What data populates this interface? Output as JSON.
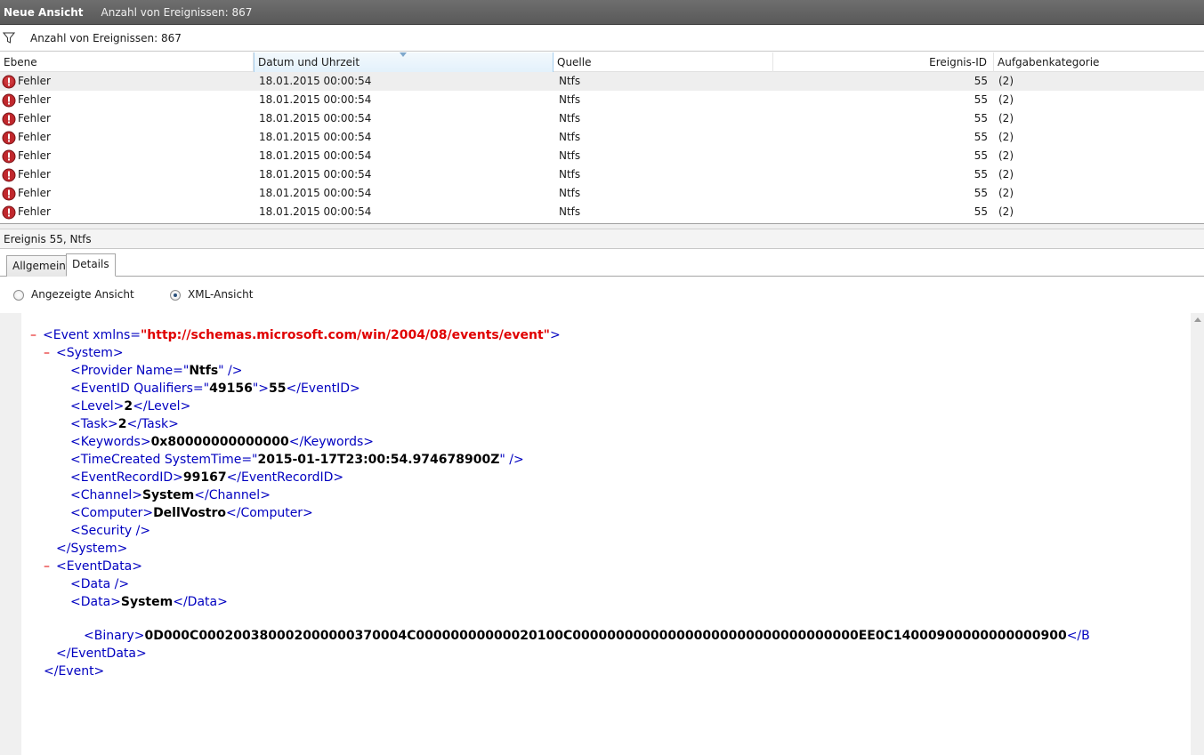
{
  "titlebar": {
    "title": "Neue Ansicht",
    "subtitle": "Anzahl von Ereignissen: 867"
  },
  "filterbar": {
    "text": "Anzahl von Ereignissen: 867",
    "icon": "funnel-icon"
  },
  "grid": {
    "columns": [
      "Ebene",
      "Datum und Uhrzeit",
      "Quelle",
      "Ereignis-ID",
      "Aufgabenkategorie"
    ],
    "sorted_column": "Datum und Uhrzeit",
    "rows": [
      {
        "level": "Fehler",
        "datetime": "18.01.2015 00:00:54",
        "source": "Ntfs",
        "event_id": "55",
        "category": "(2)"
      },
      {
        "level": "Fehler",
        "datetime": "18.01.2015 00:00:54",
        "source": "Ntfs",
        "event_id": "55",
        "category": "(2)"
      },
      {
        "level": "Fehler",
        "datetime": "18.01.2015 00:00:54",
        "source": "Ntfs",
        "event_id": "55",
        "category": "(2)"
      },
      {
        "level": "Fehler",
        "datetime": "18.01.2015 00:00:54",
        "source": "Ntfs",
        "event_id": "55",
        "category": "(2)"
      },
      {
        "level": "Fehler",
        "datetime": "18.01.2015 00:00:54",
        "source": "Ntfs",
        "event_id": "55",
        "category": "(2)"
      },
      {
        "level": "Fehler",
        "datetime": "18.01.2015 00:00:54",
        "source": "Ntfs",
        "event_id": "55",
        "category": "(2)"
      },
      {
        "level": "Fehler",
        "datetime": "18.01.2015 00:00:54",
        "source": "Ntfs",
        "event_id": "55",
        "category": "(2)"
      },
      {
        "level": "Fehler",
        "datetime": "18.01.2015 00:00:54",
        "source": "Ntfs",
        "event_id": "55",
        "category": "(2)"
      }
    ]
  },
  "event_header": "Ereignis 55, Ntfs",
  "tabs": [
    {
      "label": "Allgemein",
      "active": false
    },
    {
      "label": "Details",
      "active": true
    }
  ],
  "view_options": {
    "friendly": "Angezeigte Ansicht",
    "xml": "XML-Ansicht",
    "selected": "xml"
  },
  "xml": {
    "event_open": "<Event xmlns=",
    "event_ns": "\"http://schemas.microsoft.com/win/2004/08/events/event\"",
    "event_close_bracket": ">",
    "system_open": "<System>",
    "provider_a": "<Provider Name=",
    "provider_q1": "\"",
    "provider_val": "Ntfs",
    "provider_q2": "\"",
    "provider_b": " />",
    "eventid_a": "<EventID Qualifiers=",
    "eventid_q1": "\"",
    "eventid_qual": "49156",
    "eventid_q2": "\"",
    "eventid_gt": ">",
    "eventid_val": "55",
    "eventid_close": "</EventID>",
    "level_a": "<Level>",
    "level_val": "2",
    "level_close": "</Level>",
    "task_a": "<Task>",
    "task_val": "2",
    "task_close": "</Task>",
    "keywords_a": "<Keywords>",
    "keywords_val": "0x80000000000000",
    "keywords_close": "</Keywords>",
    "timecreated_a": "<TimeCreated SystemTime=",
    "timecreated_q1": "\"",
    "timecreated_val": "2015-01-17T23:00:54.974678900Z",
    "timecreated_q2": "\"",
    "timecreated_b": " />",
    "recordid_a": "<EventRecordID>",
    "recordid_val": "99167",
    "recordid_close": "</EventRecordID>",
    "channel_a": "<Channel>",
    "channel_val": "System",
    "channel_close": "</Channel>",
    "computer_a": "<Computer>",
    "computer_val": "DellVostro",
    "computer_close": "</Computer>",
    "security": "<Security />",
    "system_close": "</System>",
    "eventdata_open": "<EventData>",
    "data_empty": "<Data />",
    "data_a": "<Data>",
    "data_val": "System",
    "data_close": "</Data>",
    "binary_a": "<Binary>",
    "binary_val": "0D000C000200380002000000370004C00000000000020100C000000000000000000000000000000000EE0C14000900000000000900",
    "binary_close": "</B",
    "eventdata_close": "</EventData>",
    "event_close": "</Event>",
    "minus": "–"
  }
}
